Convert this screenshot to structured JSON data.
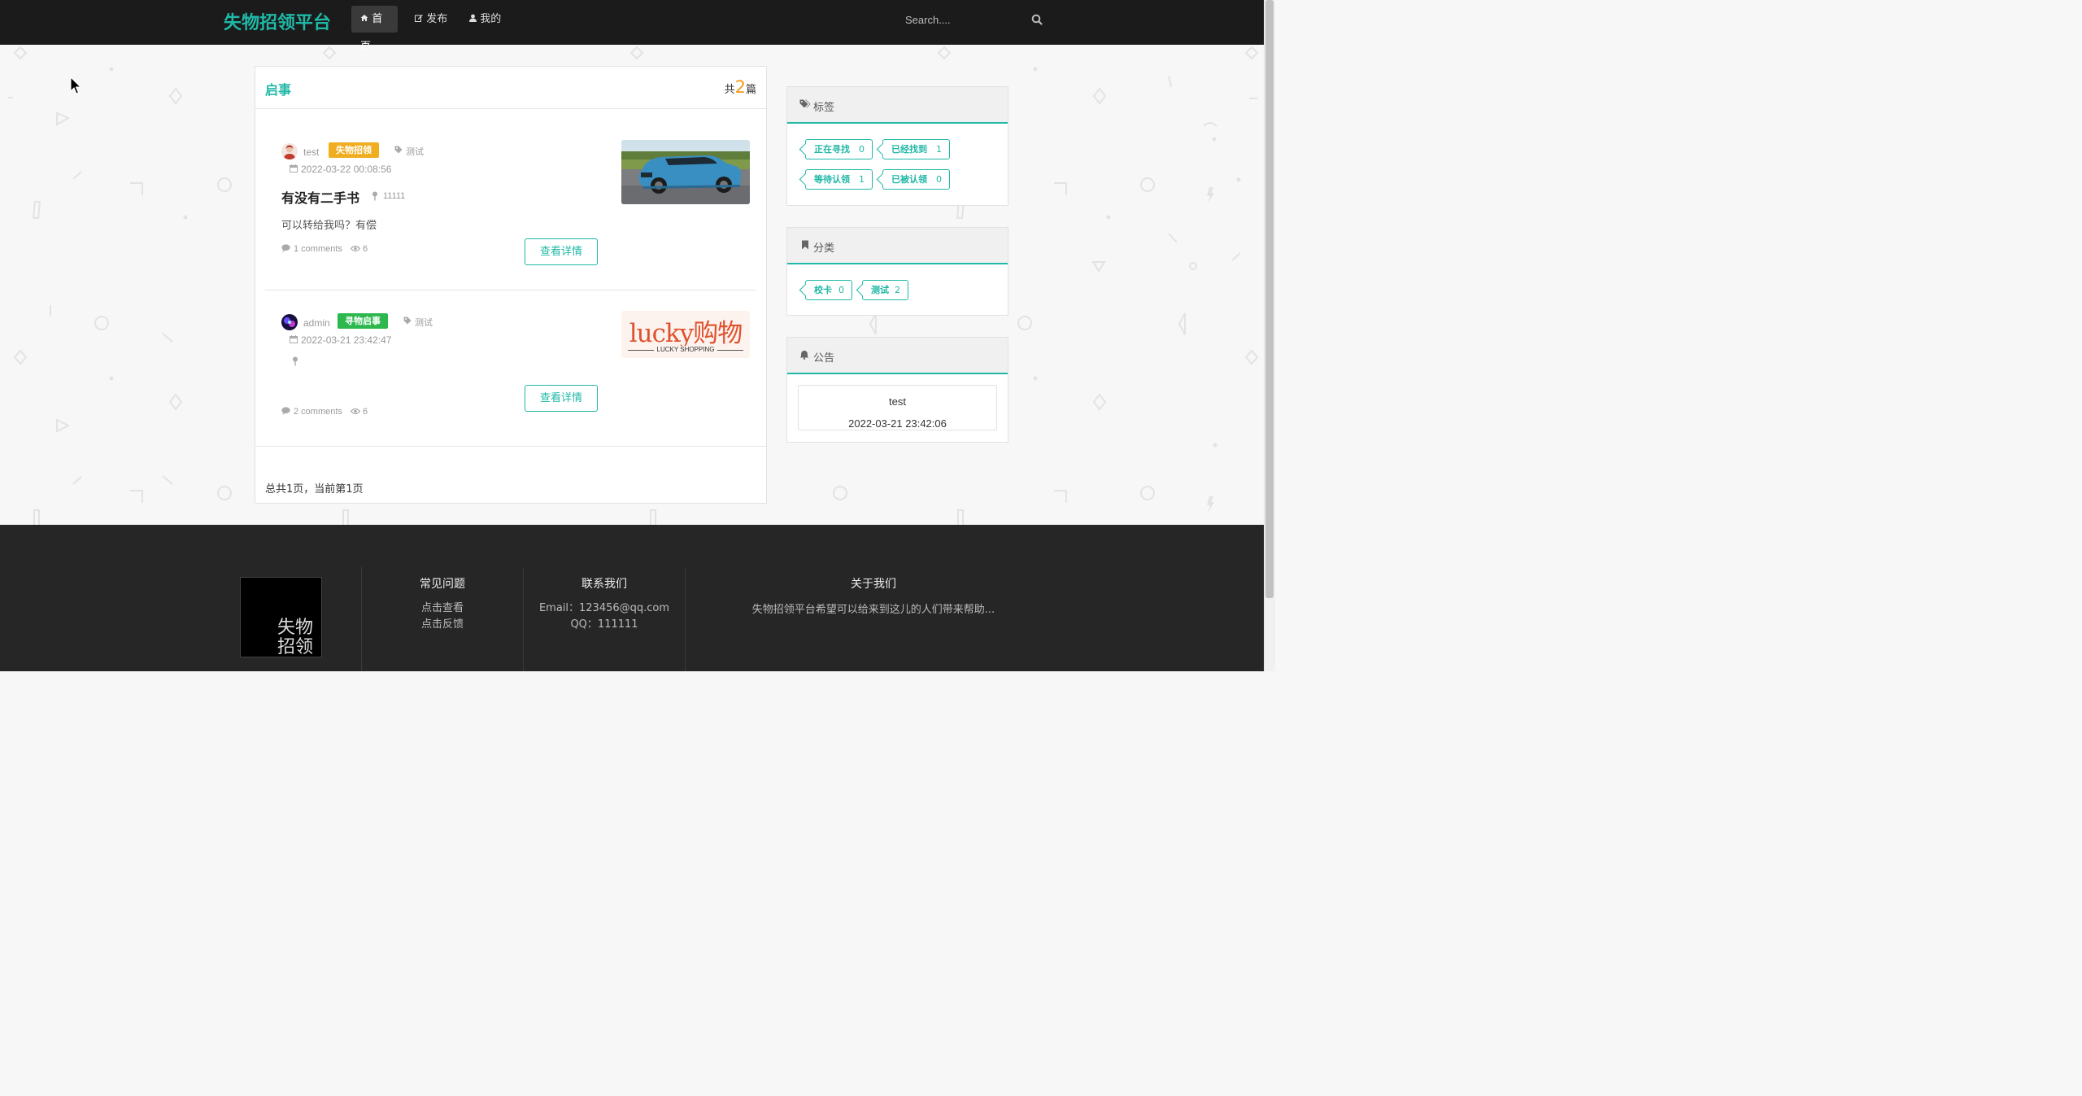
{
  "navbar": {
    "brand": "失物招领平台",
    "items": [
      {
        "label": "首页",
        "active": true,
        "icon": "home-icon"
      },
      {
        "label": "发布",
        "active": false,
        "icon": "edit-icon"
      },
      {
        "label": "我的",
        "active": false,
        "icon": "user-icon"
      }
    ],
    "search_placeholder": "Search...."
  },
  "main": {
    "title": "启事",
    "count_prefix": "共",
    "count": "2",
    "count_suffix": "篇",
    "posts": [
      {
        "author": "test",
        "badge": "失物招领",
        "badge_color": "#f0ad1f",
        "tag": "测试",
        "date": "2022-03-22 00:08:56",
        "title": "有没有二手书",
        "location": "11111",
        "description": "可以转给我吗？有偿",
        "comments": "1 comments",
        "views": "6",
        "button": "查看详情",
        "image": "blue-suv-photo"
      },
      {
        "author": "admin",
        "badge": "寻物启事",
        "badge_color": "#2db84d",
        "tag": "测试",
        "date": "2022-03-21 23:42:47",
        "title": "",
        "location": "",
        "description": "",
        "comments": "2 comments",
        "views": "6",
        "button": "查看详情",
        "image": "lucky-shopping-logo",
        "image_text": "lucky购物",
        "image_subtext": "LUCKY SHOPPING"
      }
    ],
    "pager_text": "总共1页，当前第1页"
  },
  "sidebar": {
    "tags": {
      "title": "标签",
      "items": [
        {
          "label": "正在寻找",
          "count": "0"
        },
        {
          "label": "已经找到",
          "count": "1"
        },
        {
          "label": "等待认领",
          "count": "1"
        },
        {
          "label": "已被认领",
          "count": "0"
        }
      ]
    },
    "categories": {
      "title": "分类",
      "items": [
        {
          "label": "校卡",
          "count": "0"
        },
        {
          "label": "测试",
          "count": "2"
        }
      ]
    },
    "notice": {
      "title": "公告",
      "item_title": "test",
      "item_date": "2022-03-21 23:42:06"
    }
  },
  "footer": {
    "logo_line1": "失物",
    "logo_line2": "招领",
    "faq": {
      "title": "常见问题",
      "links": [
        "点击查看",
        "点击反馈"
      ]
    },
    "contact": {
      "title": "联系我们",
      "email": "Email：123456@qq.com",
      "qq": "QQ：111111"
    },
    "about": {
      "title": "关于我们",
      "text": "失物招领平台希望可以给来到这儿的人们带来帮助..."
    }
  },
  "colors": {
    "accent": "#1fb8a6",
    "navbar": "#1b1b1b",
    "footer": "#262626",
    "count": "#f39c12"
  }
}
